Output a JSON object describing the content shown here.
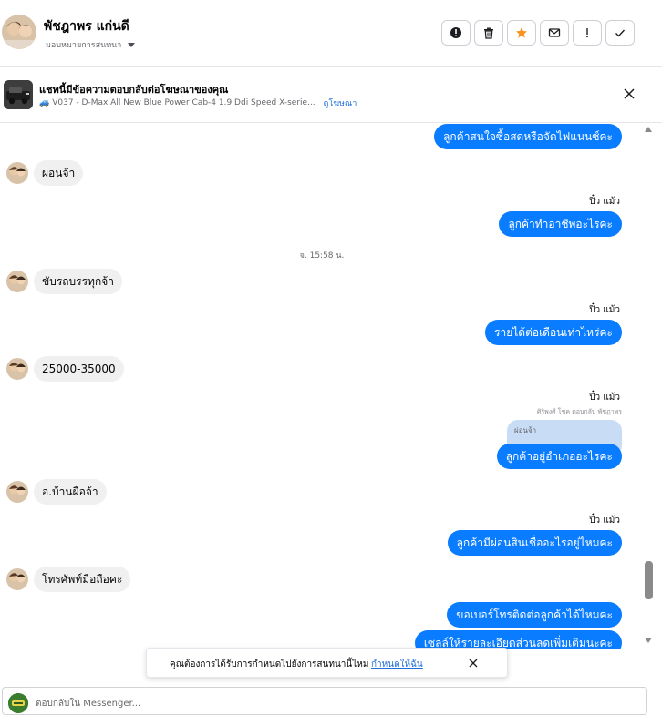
{
  "header": {
    "contact_name": "พัชฎาพร แก่นดี",
    "assign_label": "มอบหมายการสนทนา",
    "actions": [
      {
        "icon": "alert-circle-icon",
        "label": "mark-spam"
      },
      {
        "icon": "trash-icon",
        "label": "delete"
      },
      {
        "icon": "star-icon",
        "label": "star"
      },
      {
        "icon": "envelope-icon",
        "label": "mark-unread"
      },
      {
        "icon": "exclamation-icon",
        "label": "follow-up"
      },
      {
        "icon": "check-icon",
        "label": "done"
      }
    ],
    "star_color": "#f7931e"
  },
  "ad_context": {
    "title": "แชทนี้มีข้อความตอบกลับต่อโฆษณาของคุณ",
    "subtitle": "V037 - D-Max All New Blue Power Cab-4 1.9 Ddi Speed X-serie...",
    "link": "ดูโฆษณา"
  },
  "messages": [
    {
      "type": "out",
      "text": "ลูกค้าสนใจซื้อสดหรือจัดไฟแนนซ์คะ"
    },
    {
      "type": "in",
      "text": "ผ่อนจ้า"
    },
    {
      "type": "sender",
      "text": "ปิ๋ว แม้ว"
    },
    {
      "type": "out",
      "text": "ลูกค้าทำอาชีพอะไรคะ"
    },
    {
      "type": "time",
      "text": "จ. 15:58 น."
    },
    {
      "type": "in",
      "text": "ขับรถบรรทุกจ้า"
    },
    {
      "type": "sender",
      "text": "ปิ๋ว แม้ว"
    },
    {
      "type": "out",
      "text": "รายได้ต่อเดือนเท่าไหร่คะ"
    },
    {
      "type": "in",
      "text": "25000-35000"
    },
    {
      "type": "sender",
      "text": "ปิ๋ว แม้ว"
    },
    {
      "type": "reply_meta",
      "text": "ศิริพงศ์ โชค ตอบกลับ พัชฎาพร"
    },
    {
      "type": "quoted",
      "text": "ผ่อนจ้า"
    },
    {
      "type": "out",
      "text": "ลูกค้าอยู่อำเภออะไรคะ"
    },
    {
      "type": "in",
      "text": "อ.บ้านผือจ้า"
    },
    {
      "type": "sender",
      "text": "ปิ๋ว แม้ว"
    },
    {
      "type": "out",
      "text": "ลูกค้ามีผ่อนสินเชื่ออะไรอยู่ไหมคะ"
    },
    {
      "type": "in",
      "text": "โทรศัพท์มือถือคะ"
    },
    {
      "type": "out",
      "text": "ขอเบอร์โทรติดต่อลูกค้าได้ไหมคะ"
    },
    {
      "type": "out",
      "text": "เซลล์ให้รายละเอียดส่วนลดเพิ่มเติมนะคะ"
    }
  ],
  "reminder": {
    "text": "คุณต้องการได้รับการกำหนดไปยังการสนทนานี้ไหม",
    "link": "กำหนดให้ฉัน"
  },
  "reply": {
    "placeholder": "ตอบกลับใน Messenger..."
  },
  "colors": {
    "outgoing_bubble": "#0a7cff",
    "incoming_bubble": "#f0f0f0",
    "link": "#216fdb"
  }
}
